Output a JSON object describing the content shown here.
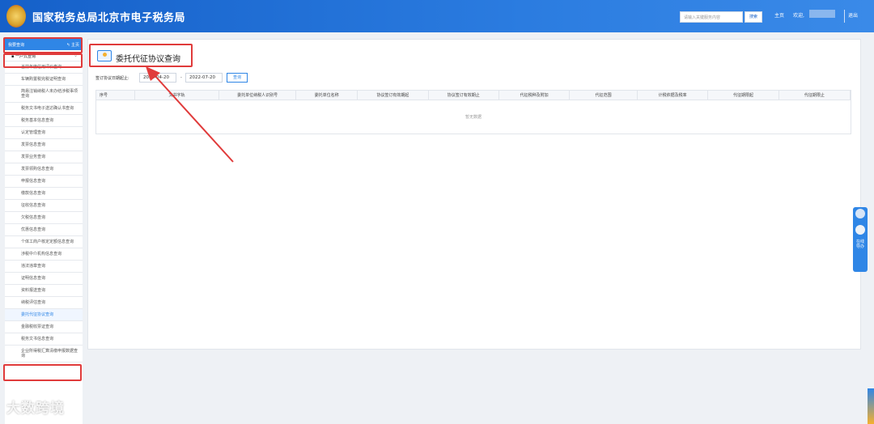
{
  "header": {
    "site_title": "国家税务总局北京市电子税务局",
    "search_placeholder": "请输入关键服务内容",
    "search_button": "搜索",
    "home_link": "主页",
    "welcome": "欢迎,",
    "logout": "退出"
  },
  "sidebar": {
    "header_label": "我要查询",
    "home_label": "主页",
    "group_label": "一户式查询",
    "items": [
      {
        "label": "当前年度信用评价查询"
      },
      {
        "label": "车辆购置税完税证明查询"
      },
      {
        "label": "简易注销纳税人未办结涉税事项查询"
      },
      {
        "label": "税务文书电子送达确认书查询"
      },
      {
        "label": "税务基本信息查询"
      },
      {
        "label": "认定管理查询"
      },
      {
        "label": "发票信息查询"
      },
      {
        "label": "发票业务查询"
      },
      {
        "label": "发票领购信息查询"
      },
      {
        "label": "申报信息查询"
      },
      {
        "label": "缴款信息查询"
      },
      {
        "label": "征收信息查询"
      },
      {
        "label": "欠税信息查询"
      },
      {
        "label": "优惠信息查询"
      },
      {
        "label": "个体工商户核定定额信息查询"
      },
      {
        "label": "涉税中介机构信息查询"
      },
      {
        "label": "违法违章查询"
      },
      {
        "label": "证明信息查询"
      },
      {
        "label": "资料报送查询"
      },
      {
        "label": "纳税评估查询"
      },
      {
        "label": "委托代征协议查询",
        "active": true
      },
      {
        "label": "金融税收票证查询"
      },
      {
        "label": "税务文书信息查询"
      },
      {
        "label": "企业所得税汇算清缴申报数据查询"
      }
    ]
  },
  "main": {
    "page_title": "委托代征协议查询",
    "filter_label": "签订协议日期起止:",
    "date_start": "2022-04-20",
    "date_sep": "-",
    "date_end": "2022-07-20",
    "query_button": "查询",
    "table_columns": [
      "序号",
      "文书字轨",
      "委托单位纳税人识别号",
      "委托单位名称",
      "协议签订有效期起",
      "协议签订有效期止",
      "代征税种及附加",
      "代征范围",
      "计税依据及税率",
      "代征期限起",
      "代征期限止"
    ],
    "empty_text": "暂无数据"
  },
  "float_widget": {
    "label": "在线导办"
  },
  "watermark": "大数跨境",
  "colors": {
    "header_blue": "#1560c9",
    "accent_blue": "#2f86e6",
    "highlight_red": "#e03b3b"
  }
}
